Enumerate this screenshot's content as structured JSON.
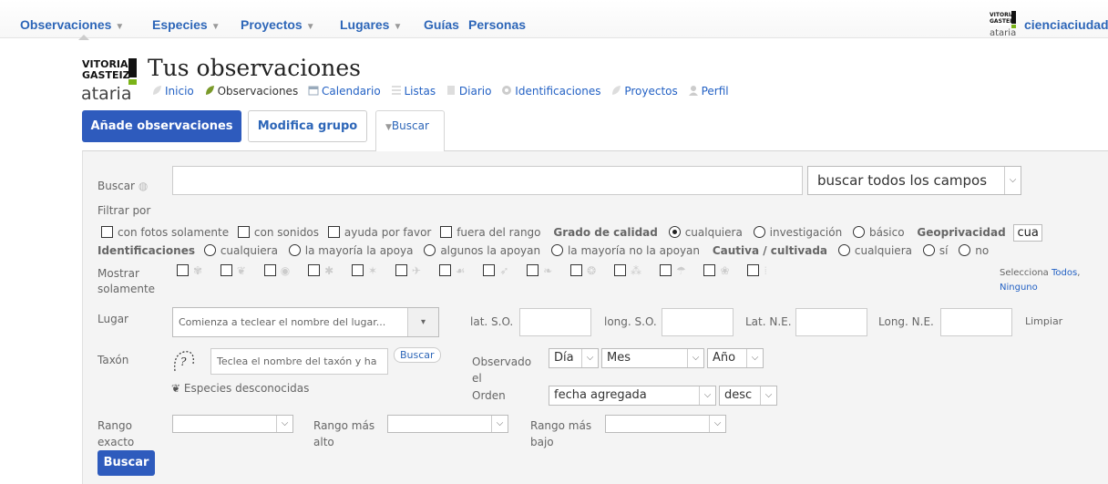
{
  "topnav": {
    "items": [
      "Observaciones",
      "Especies",
      "Proyectos",
      "Lugares",
      "Guías",
      "Personas"
    ],
    "user": "cienciaciudada"
  },
  "header": {
    "title": "Tus observaciones",
    "subnav": [
      "Inicio",
      "Observaciones",
      "Calendario",
      "Listas",
      "Diario",
      "Identificaciones",
      "Proyectos",
      "Perfil"
    ],
    "logo_text": [
      "VITORIA",
      "GASTEIZ",
      "ataria"
    ]
  },
  "actions": {
    "add": "Añade observaciones",
    "group": "Modifica grupo",
    "search_tab": "Buscar"
  },
  "search": {
    "label": "Buscar",
    "scope": "buscar todos los campos",
    "filter_label": "Filtrar por",
    "filters": [
      "con fotos solamente",
      "con sonidos",
      "ayuda por favor",
      "fuera del rango"
    ],
    "quality_label": "Grado de calidad",
    "quality_options": [
      "cualquiera",
      "investigación",
      "básico"
    ],
    "geoprivacy_label": "Geoprivacidad",
    "geoprivacy_value": "cua",
    "id_label": "Identificaciones",
    "id_options": [
      "cualquiera",
      "la mayoría la apoya",
      "algunos la apoyan",
      "la mayoría no la apoyan"
    ],
    "captive_label": "Cautiva / cultivada",
    "captive_options": [
      "cualquiera",
      "sí",
      "no"
    ],
    "show_only_label": "Mostrar solamente",
    "select_text": "Selecciona",
    "select_all": "Todos",
    "select_none": "Ninguno",
    "place_label": "Lugar",
    "place_placeholder": "Comienza a teclear el nombre del lugar...",
    "sw_lat": "lat. S.O.",
    "sw_lng": "long. S.O.",
    "ne_lat": "Lat. N.E.",
    "ne_lng": "Long. N.E.",
    "clear": "Limpiar",
    "taxon_label": "Taxón",
    "taxon_placeholder": "Teclea el nombre del taxón y ha",
    "taxon_button": "Buscar",
    "unknown_species": "Especies desconocidas",
    "observed_label": "Observado el",
    "day": "Día",
    "month": "Mes",
    "year": "Año",
    "order_label": "Orden",
    "order_value": "fecha agregada",
    "order_dir": "desc",
    "rank_exact": "Rango exacto",
    "rank_high": "Rango más alto",
    "rank_low": "Rango más bajo",
    "submit": "Buscar"
  },
  "colors": {
    "accent": "#2e5bbd",
    "link": "#2d66b8",
    "panel": "#f4f4f4"
  }
}
